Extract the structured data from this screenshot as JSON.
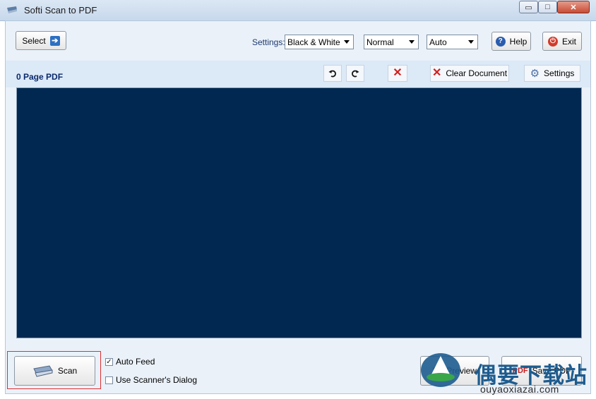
{
  "window": {
    "title": "Softi Scan to PDF",
    "buttons": {
      "minimize": "▭",
      "maximize": "□",
      "close": "✕"
    }
  },
  "toolbar": {
    "select_label": "Select",
    "settings_label": "Settings:",
    "color_mode": "Black & White",
    "quality": "Normal",
    "size": "Auto",
    "help_label": "Help",
    "exit_label": "Exit"
  },
  "document": {
    "page_count": "0 Page PDF",
    "clear_label": "Clear Document",
    "settings_label": "Settings"
  },
  "bottom": {
    "scan_label": "Scan",
    "auto_feed_label": "Auto Feed",
    "auto_feed_checked": "✓",
    "scanner_dialog_label": "Use Scanner's Dialog",
    "preview_label": "Preview",
    "save_label": "Save PDF"
  },
  "watermark": {
    "brand": "偶要下载站",
    "url": "ouyaoxiazai.com"
  },
  "colors": {
    "preview_background": "#002850",
    "accent": "#2b6fc3",
    "danger": "#d23b2b"
  }
}
